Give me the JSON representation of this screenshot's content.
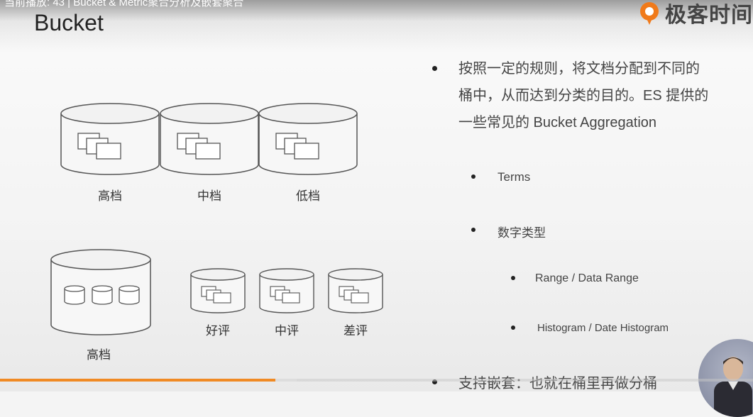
{
  "header": {
    "now_playing": "当前播放: 43 | Bucket & Metric聚合分析及嵌套聚合",
    "slide_title": "Bucket",
    "logo_text": "极客时间"
  },
  "diagram": {
    "top_buckets": [
      "高档",
      "中档",
      "低档"
    ],
    "big_bucket": "高档",
    "small_buckets": [
      "好评",
      "中评",
      "差评"
    ]
  },
  "bullets": {
    "main_line1": "按照一定的规则，将文档分配到不同的",
    "main_line2": "桶中，从而达到分类的目的。ES 提供的",
    "main_line3": "一些常见的 Bucket Aggregation",
    "sub_terms": "Terms",
    "sub_numeric": "数字类型",
    "sub_range": "Range / Data Range",
    "sub_histogram": "Histogram / Date Histogram",
    "nested": "支持嵌套：也就在桶里再做分桶"
  },
  "player": {
    "progress": 0.366,
    "accent": "#f08a24"
  }
}
